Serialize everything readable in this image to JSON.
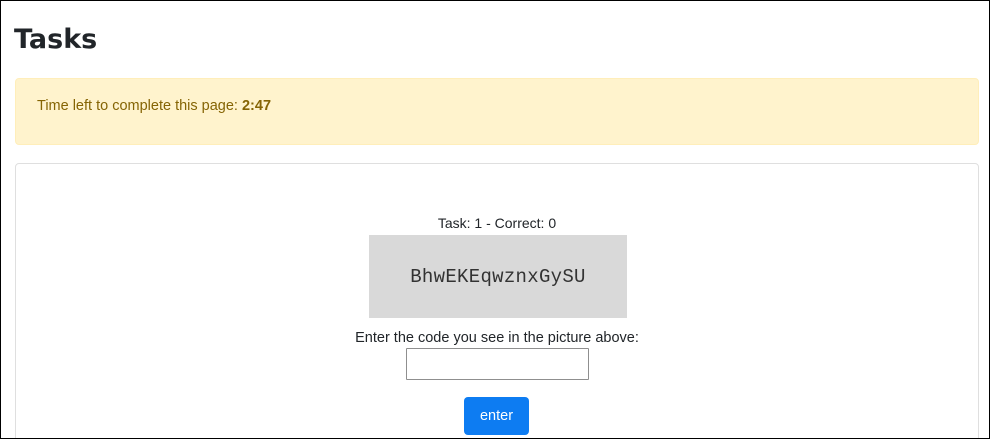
{
  "page": {
    "title": "Tasks"
  },
  "timer": {
    "label": "Time left to complete this page:",
    "value": "2:47"
  },
  "task": {
    "progress_text": "Task: 1 - Correct: 0",
    "captcha_code": "BhwEKEqwznxGySU",
    "instruction": "Enter the code you see in the picture above:",
    "input_value": "",
    "submit_label": "enter"
  },
  "colors": {
    "alert_background": "#fff3cd",
    "alert_text": "#856404",
    "captcha_background": "#d9d9d9",
    "button_primary": "#0d7cf2"
  }
}
